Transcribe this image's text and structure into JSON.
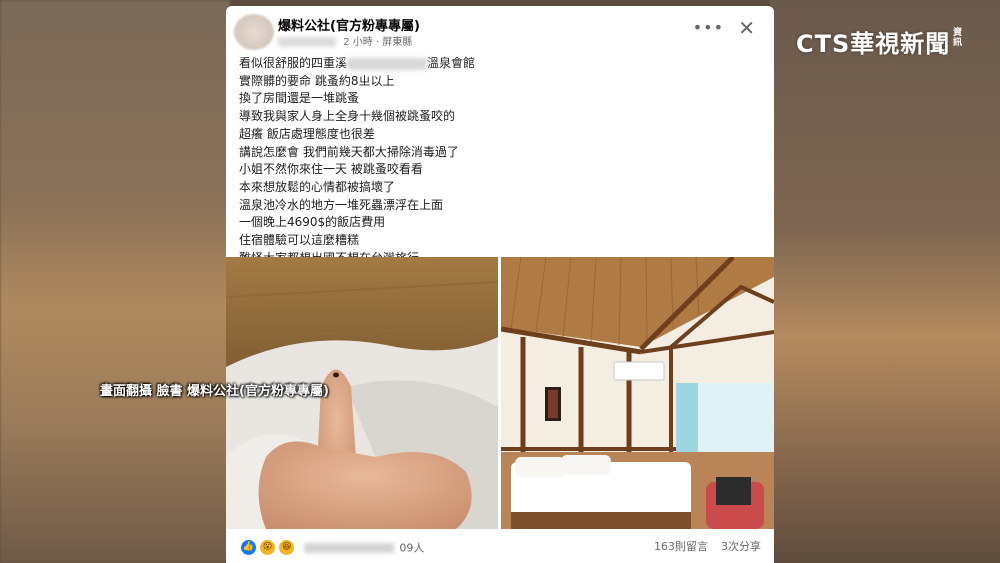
{
  "post": {
    "page_name": "爆料公社(官方粉專專屬)",
    "time": "2 小時",
    "location": "屏東縣",
    "body_lines": [
      "看似很舒服的四重溪",
      "實際髒的要命 跳蚤約8ㄓ以上",
      "換了房間還是一堆跳蚤",
      "導致我與家人身上全身十幾個被跳蚤咬的",
      "超癢 飯店處理態度也很差",
      "講說怎麼會 我們前幾天都大掃除消毒過了",
      "小姐不然你來住一天 被跳蚤咬看看",
      "本來想放鬆的心情都被搞壞了",
      "溫泉池冷水的地方一堆死蟲漂浮在上面",
      "一個晚上4690$的飯店費用",
      "住宿體驗可以這麼糟糕",
      "難怪大家都想出國不想在台灣旅行"
    ],
    "body_line1_suffix": "溫泉會館",
    "reactions": [
      "like-icon",
      "wow-icon",
      "haha-icon"
    ],
    "reaction_count": "09人",
    "comments": "163則留言",
    "shares": "3次分享",
    "more": "•••",
    "close": "✕"
  },
  "overlay": {
    "caption": "畫面翻攝 臉書 爆料公社(官方粉專專屬)",
    "logo": "CTS華視新聞",
    "logo_sub": "資訊"
  }
}
